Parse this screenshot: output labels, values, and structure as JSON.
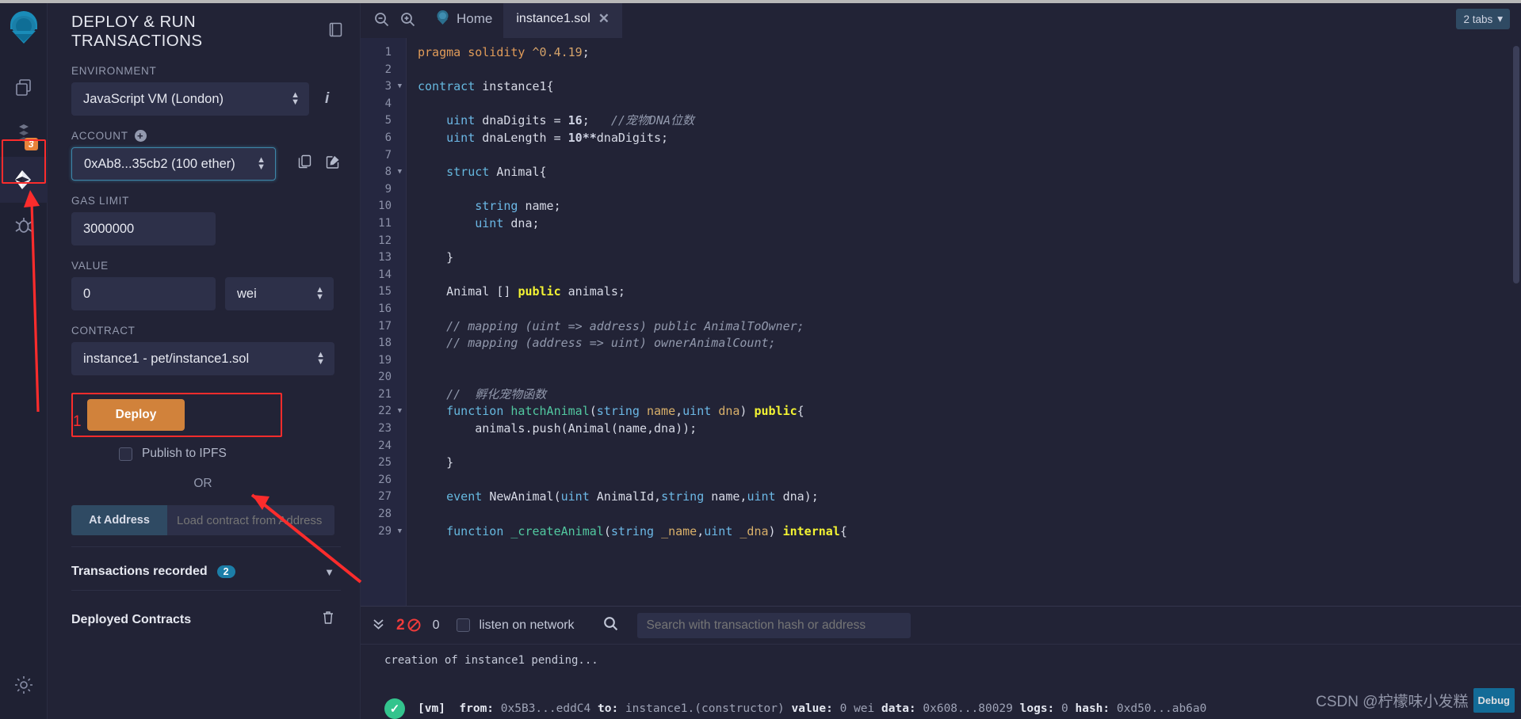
{
  "rail": {
    "logo_icon": "remix-logo-icon",
    "items": [
      {
        "name": "file-explorer",
        "icon": "copy-files-icon",
        "badge": null
      },
      {
        "name": "solidity-compiler",
        "icon": "compiler-icon",
        "badge": "3"
      },
      {
        "name": "deploy-run-transactions",
        "icon": "ethereum-icon",
        "badge": null
      },
      {
        "name": "debugger",
        "icon": "bug-icon",
        "badge": null
      }
    ],
    "settings_icon": "gear-icon"
  },
  "panel": {
    "title": "DEPLOY & RUN TRANSACTIONS",
    "head_icon": "book-icon",
    "environment": {
      "label": "ENVIRONMENT",
      "value": "JavaScript VM (London)",
      "info_icon": "info-icon"
    },
    "account": {
      "label": "ACCOUNT",
      "add_icon": "plus-circle-icon",
      "value": "0xAb8...35cb2 (100 ether)",
      "copy_icon": "copy-icon",
      "edit_icon": "edit-icon"
    },
    "gas_limit": {
      "label": "GAS LIMIT",
      "value": "3000000"
    },
    "value": {
      "label": "VALUE",
      "amount": "0",
      "unit": "wei"
    },
    "contract": {
      "label": "CONTRACT",
      "value": "instance1 - pet/instance1.sol"
    },
    "deploy_button": "Deploy",
    "publish_ipfs_label": "Publish to IPFS",
    "or_label": "OR",
    "at_address_button": "At Address",
    "at_address_placeholder": "Load contract from Address",
    "transactions_recorded": {
      "label": "Transactions recorded",
      "count": "2",
      "chevron_icon": "chevron-down-icon"
    },
    "deployed_contracts": {
      "label": "Deployed Contracts",
      "trash_icon": "trash-icon"
    }
  },
  "editor": {
    "zoom_out_icon": "zoom-out-icon",
    "zoom_in_icon": "zoom-in-icon",
    "home_icon": "remix-home-icon",
    "home_label": "Home",
    "file_tab": {
      "label": "instance1.sol",
      "close_icon": "close-icon"
    },
    "tabs_badge": {
      "label": "2 tabs",
      "caret_icon": "caret-down-icon"
    },
    "lines": [
      {
        "n": "1",
        "fold": false,
        "tokens": [
          {
            "t": "pragma ",
            "c": "k-pragma"
          },
          {
            "t": "solidity ",
            "c": "k-pragma"
          },
          {
            "t": "^0.4.19",
            "c": "k-ver"
          },
          {
            "t": ";",
            "c": "k-plain"
          }
        ]
      },
      {
        "n": "2",
        "fold": false,
        "tokens": []
      },
      {
        "n": "3",
        "fold": true,
        "tokens": [
          {
            "t": "contract ",
            "c": "k-kw"
          },
          {
            "t": "instance1{",
            "c": "k-plain"
          }
        ]
      },
      {
        "n": "4",
        "fold": false,
        "tokens": []
      },
      {
        "n": "5",
        "fold": false,
        "tokens": [
          {
            "t": "    ",
            "c": "k-plain"
          },
          {
            "t": "uint",
            "c": "k-type"
          },
          {
            "t": " dnaDigits = ",
            "c": "k-plain"
          },
          {
            "t": "16",
            "c": "k-num"
          },
          {
            "t": ";   ",
            "c": "k-plain"
          },
          {
            "t": "//宠物DNA位数",
            "c": "k-cmt"
          }
        ]
      },
      {
        "n": "6",
        "fold": false,
        "tokens": [
          {
            "t": "    ",
            "c": "k-plain"
          },
          {
            "t": "uint",
            "c": "k-type"
          },
          {
            "t": " dnaLength = ",
            "c": "k-plain"
          },
          {
            "t": "10",
            "c": "k-num"
          },
          {
            "t": "**",
            "c": "k-num"
          },
          {
            "t": "dnaDigits;",
            "c": "k-plain"
          }
        ]
      },
      {
        "n": "7",
        "fold": false,
        "tokens": []
      },
      {
        "n": "8",
        "fold": true,
        "tokens": [
          {
            "t": "    ",
            "c": "k-plain"
          },
          {
            "t": "struct ",
            "c": "k-kw"
          },
          {
            "t": "Animal{",
            "c": "k-plain"
          }
        ]
      },
      {
        "n": "9",
        "fold": false,
        "tokens": []
      },
      {
        "n": "10",
        "fold": false,
        "tokens": [
          {
            "t": "        ",
            "c": "k-plain"
          },
          {
            "t": "string",
            "c": "k-type"
          },
          {
            "t": " name;",
            "c": "k-plain"
          }
        ]
      },
      {
        "n": "11",
        "fold": false,
        "tokens": [
          {
            "t": "        ",
            "c": "k-plain"
          },
          {
            "t": "uint",
            "c": "k-type"
          },
          {
            "t": " dna;",
            "c": "k-plain"
          }
        ]
      },
      {
        "n": "12",
        "fold": false,
        "tokens": []
      },
      {
        "n": "13",
        "fold": false,
        "tokens": [
          {
            "t": "    }",
            "c": "k-plain"
          }
        ]
      },
      {
        "n": "14",
        "fold": false,
        "tokens": []
      },
      {
        "n": "15",
        "fold": false,
        "tokens": [
          {
            "t": "    Animal [] ",
            "c": "k-plain"
          },
          {
            "t": "public",
            "c": "k-mod"
          },
          {
            "t": " animals;",
            "c": "k-plain"
          }
        ]
      },
      {
        "n": "16",
        "fold": false,
        "tokens": []
      },
      {
        "n": "17",
        "fold": false,
        "tokens": [
          {
            "t": "    // mapping (uint => address) public AnimalToOwner;",
            "c": "k-cmt"
          }
        ]
      },
      {
        "n": "18",
        "fold": false,
        "tokens": [
          {
            "t": "    // mapping (address => uint) ownerAnimalCount;",
            "c": "k-cmt"
          }
        ]
      },
      {
        "n": "19",
        "fold": false,
        "tokens": []
      },
      {
        "n": "20",
        "fold": false,
        "tokens": []
      },
      {
        "n": "21",
        "fold": false,
        "tokens": [
          {
            "t": "    //  孵化宠物函数",
            "c": "k-cmt"
          }
        ]
      },
      {
        "n": "22",
        "fold": true,
        "tokens": [
          {
            "t": "    ",
            "c": "k-plain"
          },
          {
            "t": "function ",
            "c": "k-kw"
          },
          {
            "t": "hatchAnimal",
            "c": "k-fn"
          },
          {
            "t": "(",
            "c": "k-plain"
          },
          {
            "t": "string",
            "c": "k-type"
          },
          {
            "t": " ",
            "c": "k-plain"
          },
          {
            "t": "name",
            "c": "k-param"
          },
          {
            "t": ",",
            "c": "k-plain"
          },
          {
            "t": "uint",
            "c": "k-type"
          },
          {
            "t": " ",
            "c": "k-plain"
          },
          {
            "t": "dna",
            "c": "k-param"
          },
          {
            "t": ") ",
            "c": "k-plain"
          },
          {
            "t": "public",
            "c": "k-mod"
          },
          {
            "t": "{",
            "c": "k-plain"
          }
        ]
      },
      {
        "n": "23",
        "fold": false,
        "tokens": [
          {
            "t": "        animals.push(Animal(name,dna));",
            "c": "k-plain"
          }
        ]
      },
      {
        "n": "24",
        "fold": false,
        "tokens": []
      },
      {
        "n": "25",
        "fold": false,
        "tokens": [
          {
            "t": "    }",
            "c": "k-plain"
          }
        ]
      },
      {
        "n": "26",
        "fold": false,
        "tokens": []
      },
      {
        "n": "27",
        "fold": false,
        "tokens": [
          {
            "t": "    ",
            "c": "k-plain"
          },
          {
            "t": "event ",
            "c": "k-kw"
          },
          {
            "t": "NewAnimal(",
            "c": "k-plain"
          },
          {
            "t": "uint",
            "c": "k-type"
          },
          {
            "t": " AnimalId,",
            "c": "k-plain"
          },
          {
            "t": "string",
            "c": "k-type"
          },
          {
            "t": " name,",
            "c": "k-plain"
          },
          {
            "t": "uint",
            "c": "k-type"
          },
          {
            "t": " dna);",
            "c": "k-plain"
          }
        ]
      },
      {
        "n": "28",
        "fold": false,
        "tokens": []
      },
      {
        "n": "29",
        "fold": true,
        "tokens": [
          {
            "t": "    ",
            "c": "k-plain"
          },
          {
            "t": "function ",
            "c": "k-kw"
          },
          {
            "t": "_createAnimal",
            "c": "k-fn"
          },
          {
            "t": "(",
            "c": "k-plain"
          },
          {
            "t": "string",
            "c": "k-type"
          },
          {
            "t": " ",
            "c": "k-plain"
          },
          {
            "t": "_name",
            "c": "k-param"
          },
          {
            "t": ",",
            "c": "k-plain"
          },
          {
            "t": "uint",
            "c": "k-type"
          },
          {
            "t": " ",
            "c": "k-plain"
          },
          {
            "t": "_dna",
            "c": "k-param"
          },
          {
            "t": ") ",
            "c": "k-plain"
          },
          {
            "t": "internal",
            "c": "k-mod"
          },
          {
            "t": "{",
            "c": "k-plain"
          }
        ]
      }
    ]
  },
  "terminal": {
    "collapse_icon": "chevrons-down-icon",
    "error_count": "2",
    "error_icon": "ban-icon",
    "warning_count": "0",
    "listen_label": "listen on network",
    "search_icon": "search-icon",
    "search_placeholder": "Search with transaction hash or address",
    "pending_text": "creation of instance1 pending...",
    "log": {
      "status_icon": "check-circle-icon",
      "vm_tag": "[vm]",
      "from_label": "from:",
      "from_value": "0x5B3...eddC4",
      "to_label": "to:",
      "to_value": "instance1.(constructor)",
      "value_label": "value:",
      "value_value": "0 wei",
      "data_label": "data:",
      "data_value": "0x608...80029",
      "logs_label": "logs:",
      "logs_value": "0",
      "hash_label": "hash:",
      "hash_value": "0xd50...ab6a0"
    }
  },
  "watermark": {
    "site": "CSDN @柠檬味小发糕",
    "badge": "Debug"
  },
  "annotations": {
    "step_1": "1"
  },
  "colors": {
    "accent_orange": "#d1823b",
    "highlight_red": "#fb2c2c",
    "badge_blue": "#1c7ea8",
    "badge_orange": "#e8833a",
    "success_green": "#33c48d",
    "panel_bg": "#222336",
    "input_bg": "#2d3049"
  }
}
